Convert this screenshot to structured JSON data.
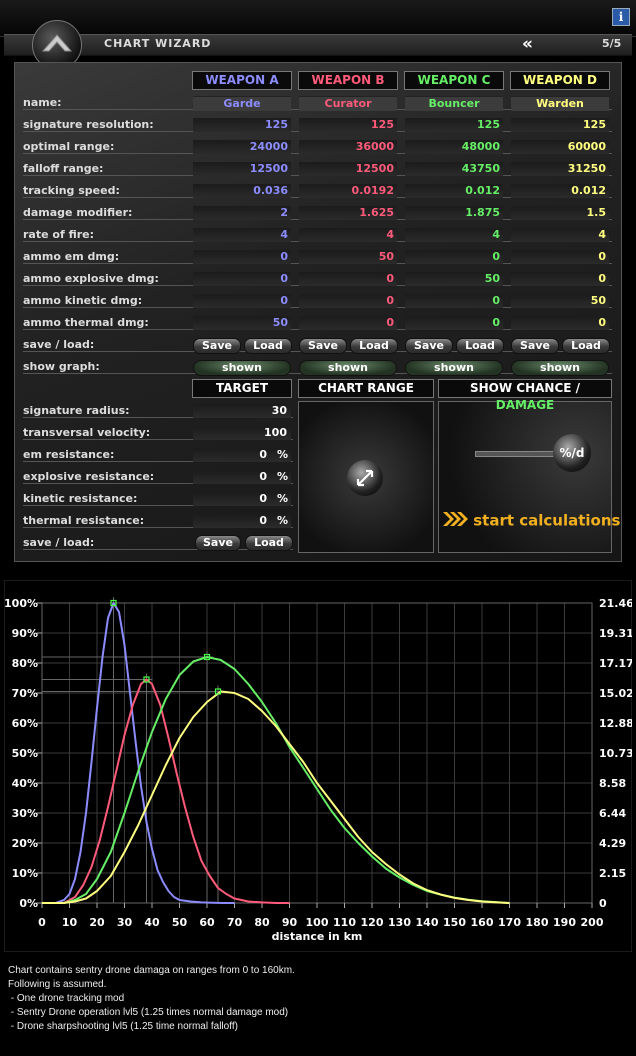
{
  "window": {
    "info_icon": "info-icon"
  },
  "header": {
    "title": "CHART WIZARD",
    "back_label": "«",
    "step": "5/5"
  },
  "weapons": [
    {
      "header": "WEAPON A",
      "color": "#8c8cff",
      "name": "Garde",
      "values": [
        "125",
        "24000",
        "12500",
        "0.036",
        "2",
        "4",
        "0",
        "0",
        "0",
        "50"
      ],
      "save": "Save",
      "load": "Load",
      "show": "shown"
    },
    {
      "header": "WEAPON B",
      "color": "#ff5a7a",
      "name": "Curator",
      "values": [
        "125",
        "36000",
        "12500",
        "0.0192",
        "1.625",
        "4",
        "50",
        "0",
        "0",
        "0"
      ],
      "save": "Save",
      "load": "Load",
      "show": "shown"
    },
    {
      "header": "WEAPON C",
      "color": "#66ee66",
      "name": "Bouncer",
      "values": [
        "125",
        "48000",
        "43750",
        "0.012",
        "1.875",
        "4",
        "0",
        "50",
        "0",
        "0"
      ],
      "save": "Save",
      "load": "Load",
      "show": "shown"
    },
    {
      "header": "WEAPON D",
      "color": "#ffff80",
      "name": "Warden",
      "values": [
        "125",
        "60000",
        "31250",
        "0.012",
        "1.5",
        "4",
        "0",
        "0",
        "50",
        "0"
      ],
      "save": "Save",
      "load": "Load",
      "show": "shown"
    }
  ],
  "row_labels": {
    "name": "name:",
    "params": [
      "signature resolution:",
      "optimal range:",
      "falloff range:",
      "tracking speed:",
      "damage modifier:",
      "rate of fire:",
      "ammo em dmg:",
      "ammo explosive dmg:",
      "ammo kinetic dmg:",
      "ammo thermal dmg:"
    ],
    "save_load": "save / load:",
    "show_graph": "show graph:"
  },
  "target": {
    "header": "TARGET",
    "rows": [
      {
        "label": "signature radius:",
        "value": "30",
        "unit": ""
      },
      {
        "label": "transversal velocity:",
        "value": "100",
        "unit": ""
      },
      {
        "label": "em resistance:",
        "value": "0",
        "unit": "%"
      },
      {
        "label": "explosive resistance:",
        "value": "0",
        "unit": "%"
      },
      {
        "label": "kinetic resistance:",
        "value": "0",
        "unit": "%"
      },
      {
        "label": "thermal resistance:",
        "value": "0",
        "unit": "%"
      }
    ],
    "save_load_label": "save / load:",
    "save": "Save",
    "load": "Load"
  },
  "chart_range": {
    "header": "CHART RANGE",
    "icon": "resize-arrows-icon"
  },
  "show_mode": {
    "header_prefix": "SHOW CHANCE / ",
    "header_suffix": "DAMAGE",
    "suffix_color": "#66ee66",
    "toggle_symbol": "%/d",
    "start_label": "start calculations",
    "start_color": "#f0b020",
    "start_icon": "chevron-arrows-icon"
  },
  "chart_data": {
    "type": "line",
    "xlabel": "distance in km",
    "xlim": [
      0,
      200
    ],
    "ylim": [
      0,
      100
    ],
    "x_ticks": [
      "0",
      "10",
      "20",
      "30",
      "40",
      "50",
      "60",
      "70",
      "80",
      "90",
      "100",
      "110",
      "120",
      "130",
      "140",
      "150",
      "160",
      "170",
      "180",
      "190",
      "200"
    ],
    "y_ticks_left": [
      "0%",
      "10%",
      "20%",
      "30%",
      "40%",
      "50%",
      "60%",
      "70%",
      "80%",
      "90%",
      "100%"
    ],
    "y_ticks_right": [
      "0",
      "2.15",
      "4.29",
      "6.44",
      "8.58",
      "10.73",
      "12.88",
      "15.02",
      "17.17",
      "19.31",
      "21.46"
    ],
    "grid": true,
    "series": [
      {
        "color": "#8c8cff",
        "x": [
          0,
          5,
          8,
          10,
          12,
          14,
          16,
          18,
          20,
          22,
          24,
          26,
          28,
          30,
          32,
          34,
          36,
          38,
          40,
          42,
          44,
          46,
          48,
          50,
          54,
          58,
          62,
          66,
          70
        ],
        "y": [
          0,
          0,
          1,
          3,
          8,
          17,
          30,
          47,
          65,
          82,
          95,
          100,
          97,
          86,
          70,
          54,
          39,
          27,
          18,
          11,
          7,
          4,
          2,
          1,
          0.5,
          0.2,
          0.1,
          0,
          0
        ]
      },
      {
        "color": "#ff5a7a",
        "x": [
          0,
          8,
          10,
          12,
          15,
          18,
          21,
          24,
          27,
          30,
          33,
          36,
          38,
          40,
          43,
          46,
          49,
          52,
          55,
          58,
          61,
          64,
          67,
          70,
          75,
          80,
          85,
          90
        ],
        "y": [
          0,
          0,
          1,
          2,
          6,
          12,
          21,
          32,
          44,
          56,
          66,
          73,
          74.5,
          73,
          66,
          55,
          43,
          32,
          22,
          14,
          9,
          5,
          3,
          1.5,
          0.5,
          0.2,
          0,
          0
        ]
      },
      {
        "color": "#66ee66",
        "x": [
          0,
          8,
          12,
          16,
          20,
          25,
          30,
          35,
          40,
          45,
          50,
          55,
          60,
          65,
          70,
          75,
          80,
          85,
          90,
          95,
          100,
          105,
          110,
          115,
          120,
          125,
          130,
          135,
          140,
          145,
          150,
          155,
          160,
          165,
          170
        ],
        "y": [
          0,
          0,
          1,
          3,
          8,
          17,
          30,
          44,
          57,
          68,
          76,
          80.5,
          82,
          81,
          78,
          73,
          67,
          60,
          52,
          45,
          38,
          31,
          25,
          20,
          15.5,
          11.5,
          8.5,
          6,
          4,
          2.8,
          1.8,
          1.1,
          0.6,
          0.3,
          0
        ]
      },
      {
        "color": "#ffff80",
        "x": [
          0,
          8,
          12,
          16,
          20,
          25,
          30,
          35,
          40,
          45,
          50,
          55,
          60,
          65,
          70,
          75,
          80,
          85,
          90,
          95,
          100,
          105,
          110,
          115,
          120,
          125,
          130,
          135,
          140,
          145,
          150,
          155,
          160,
          165,
          170
        ],
        "y": [
          0,
          0,
          0.5,
          1.5,
          4,
          9,
          17,
          26,
          36,
          46,
          55,
          62,
          67,
          70.5,
          70,
          68,
          64,
          59,
          53,
          47,
          40,
          34,
          28,
          22,
          17,
          13,
          9.5,
          6.5,
          4.3,
          2.8,
          1.7,
          1,
          0.5,
          0.2,
          0
        ]
      }
    ],
    "markers": [
      {
        "color": "#8c8cff",
        "x": 26,
        "y": 100
      },
      {
        "color": "#ff5a7a",
        "x": 38,
        "y": 74.5
      },
      {
        "color": "#66ee66",
        "x": 60,
        "y": 82
      },
      {
        "color": "#ffff80",
        "x": 64,
        "y": 70.5
      }
    ]
  },
  "footer": {
    "lines": [
      "Chart contains sentry drone damaga on ranges from 0 to 160km.",
      "Following is assumed.",
      " - One drone tracking mod",
      " - Sentry Drone operation lvl5 (1.25 times normal damage mod)",
      " - Drone sharpshooting lvl5 (1.25 time normal falloff)"
    ]
  }
}
